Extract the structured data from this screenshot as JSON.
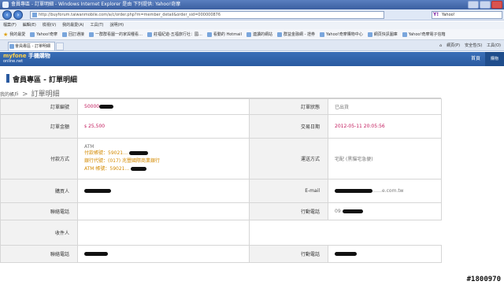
{
  "window": {
    "title": "會員專區 - 訂單明細 - Windows Internet Explorer 是由 下列提供: Yahoo!奇摩"
  },
  "browser": {
    "url": "http://buyforum.taiwanmobile.com/a/c/order.php?m=member_detail&order_sid=000000876",
    "search_placeholder": "Yahoo!",
    "search_logo": "Y!",
    "menu": [
      "檔案(F)",
      "編輯(E)",
      "檢視(V)",
      "我的最愛(A)",
      "工具(T)",
      "說明(H)"
    ],
    "favorites_label": "我的最愛",
    "favorites": [
      "Yahoo!奇摩",
      "回訂通接",
      "一群群看圖一的家與種看…",
      "莊福紀遊-五福旅行社：國…",
      "看動的 Hotmail",
      "連讀的網站",
      "群益金融網 - 證券",
      "Yahoo!奇摩購物中心",
      "網頁快訊圖庫",
      "Yahoo!奇摩電子信箱"
    ],
    "tab_label": "會員專區 - 訂單明細",
    "tools": [
      "網頁(P)",
      "安全性(S)",
      "工具(O)"
    ]
  },
  "site": {
    "logo_top": "myfone",
    "logo_brand": "手機購物",
    "logo_sub": "online.net",
    "home_label": "首頁",
    "cart_label": "購物"
  },
  "page": {
    "title": "會員專區 - 訂單明細",
    "breadcrumb_root": "我的帳戶",
    "breadcrumb_arrow": ">",
    "breadcrumb_current": "訂單明細"
  },
  "order": {
    "order_no_label": "訂單編號",
    "order_no_value": "50000",
    "status_label": "訂單狀態",
    "status_value": "已出貨",
    "amount_label": "訂單金額",
    "amount_currency": "$",
    "amount_value": "25,500",
    "trade_date_label": "交易日期",
    "trade_date_value": "2012-05-11 20:05:56",
    "payment_label": "付款方式",
    "payment_method": "ATM",
    "payment_line1": "付款帳號：59021…",
    "payment_line2": "銀行代號：(017) 兆豐國際商業銀行",
    "payment_line3": "ATM 帳號：59021…",
    "shipping_label": "運送方式",
    "shipping_value": "宅配 (黑貓宅急便)",
    "buyer_label": "購買人",
    "email_label": "E-mail",
    "email_value": "……e.com.tw",
    "contact_phone_label": "聯絡電話",
    "mobile_label": "行動電話",
    "mobile_value": "09",
    "recipient_label": "收件人",
    "contact_phone_label2": "聯絡電話",
    "mobile_label2": "行動電話"
  },
  "watermark": "#1800970"
}
